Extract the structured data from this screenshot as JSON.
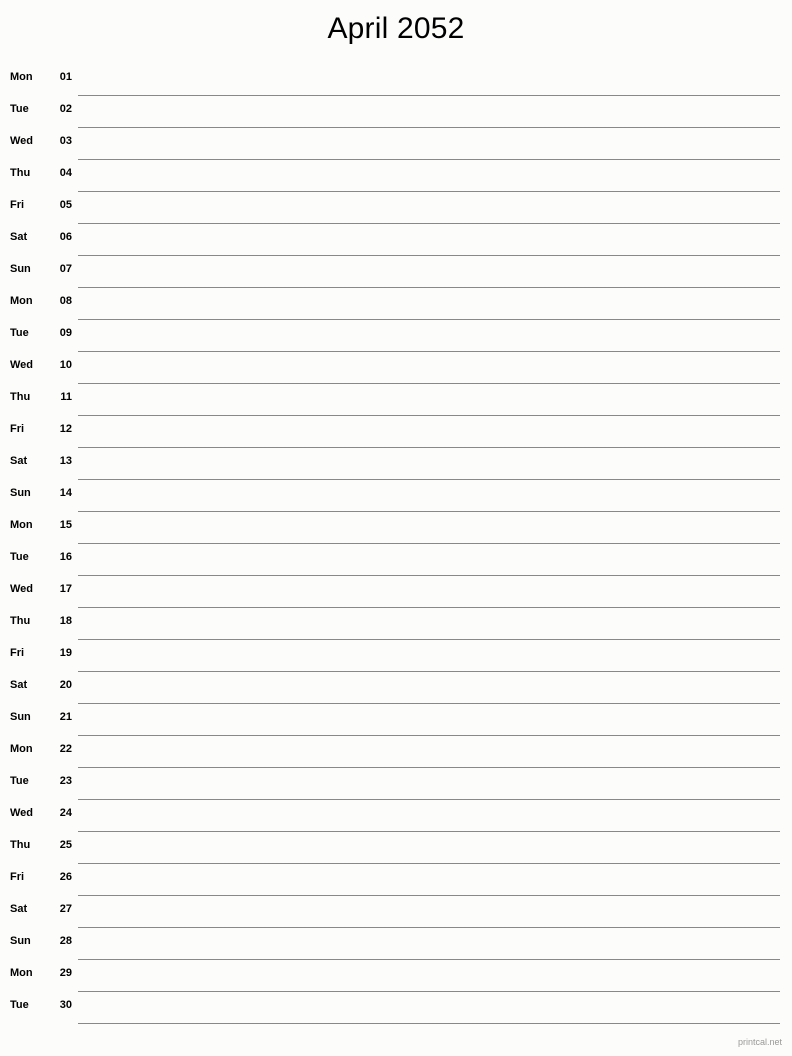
{
  "page": {
    "title": "April 2052",
    "background_color": "#fcfcfa",
    "line_color": "#888888",
    "text_color": "#000000",
    "footer_color": "#999999"
  },
  "footer": {
    "label": "printcal.net"
  },
  "days": [
    {
      "weekday": "Mon",
      "date": "01"
    },
    {
      "weekday": "Tue",
      "date": "02"
    },
    {
      "weekday": "Wed",
      "date": "03"
    },
    {
      "weekday": "Thu",
      "date": "04"
    },
    {
      "weekday": "Fri",
      "date": "05"
    },
    {
      "weekday": "Sat",
      "date": "06"
    },
    {
      "weekday": "Sun",
      "date": "07"
    },
    {
      "weekday": "Mon",
      "date": "08"
    },
    {
      "weekday": "Tue",
      "date": "09"
    },
    {
      "weekday": "Wed",
      "date": "10"
    },
    {
      "weekday": "Thu",
      "date": "11"
    },
    {
      "weekday": "Fri",
      "date": "12"
    },
    {
      "weekday": "Sat",
      "date": "13"
    },
    {
      "weekday": "Sun",
      "date": "14"
    },
    {
      "weekday": "Mon",
      "date": "15"
    },
    {
      "weekday": "Tue",
      "date": "16"
    },
    {
      "weekday": "Wed",
      "date": "17"
    },
    {
      "weekday": "Thu",
      "date": "18"
    },
    {
      "weekday": "Fri",
      "date": "19"
    },
    {
      "weekday": "Sat",
      "date": "20"
    },
    {
      "weekday": "Sun",
      "date": "21"
    },
    {
      "weekday": "Mon",
      "date": "22"
    },
    {
      "weekday": "Tue",
      "date": "23"
    },
    {
      "weekday": "Wed",
      "date": "24"
    },
    {
      "weekday": "Thu",
      "date": "25"
    },
    {
      "weekday": "Fri",
      "date": "26"
    },
    {
      "weekday": "Sat",
      "date": "27"
    },
    {
      "weekday": "Sun",
      "date": "28"
    },
    {
      "weekday": "Mon",
      "date": "29"
    },
    {
      "weekday": "Tue",
      "date": "30"
    }
  ]
}
